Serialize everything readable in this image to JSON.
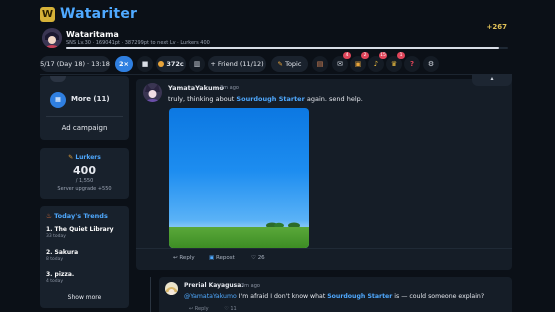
{
  "app": {
    "logo_letter": "W",
    "name": "Watariter",
    "points_badge": "+267"
  },
  "user": {
    "name": "Wataritama",
    "stats": "SNS Lv.30 · 169041pt · 387299pt to next Lv · Lurkers 400",
    "progress_fraction": 0.98
  },
  "toolbar": {
    "date": "5/17 (Day 18) · 13:18",
    "speed": "2×",
    "coins": "372c",
    "friend": "+ Friend (11/12)",
    "topic": "Topic",
    "badges": {
      "mail": "4",
      "gift": "2",
      "bell": "15",
      "trophy": "1"
    }
  },
  "sidebar": {
    "more_label": "More (11)",
    "ad_campaign": "Ad campaign",
    "lurkers": {
      "title": "Lurkers",
      "count": "400",
      "max": "/ 1,550",
      "upgrade": "Server upgrade +550"
    },
    "trends": {
      "title": "Today's Trends",
      "items": [
        {
          "name": "1. The Quiet Library",
          "count": "33 today"
        },
        {
          "name": "2. Sakura",
          "count": "8 today"
        },
        {
          "name": "3. pizza.",
          "count": "4 today"
        }
      ],
      "show_more": "Show more"
    }
  },
  "post": {
    "author": "YamataYakumo",
    "time": "3m ago",
    "text_before": "truly, thinking about ",
    "highlight": "Sourdough Starter",
    "text_after": " again. send help.",
    "reply_label": "Reply",
    "repost_label": "Repost",
    "likes": "26"
  },
  "reply": {
    "author": "Prerial Kayagusa.",
    "time": "3m ago",
    "mention": "@YamataYakumo",
    "text_mid": " I'm afraid I don't know what ",
    "highlight": "Sourdough Starter",
    "text_after": " is — could someone explain?",
    "reply_label": "Reply",
    "likes": "11"
  },
  "colors": {
    "accent": "#4fa9ff",
    "primary_button": "#2f7fe0",
    "badge": "#e0455a",
    "points": "#e2c258"
  }
}
